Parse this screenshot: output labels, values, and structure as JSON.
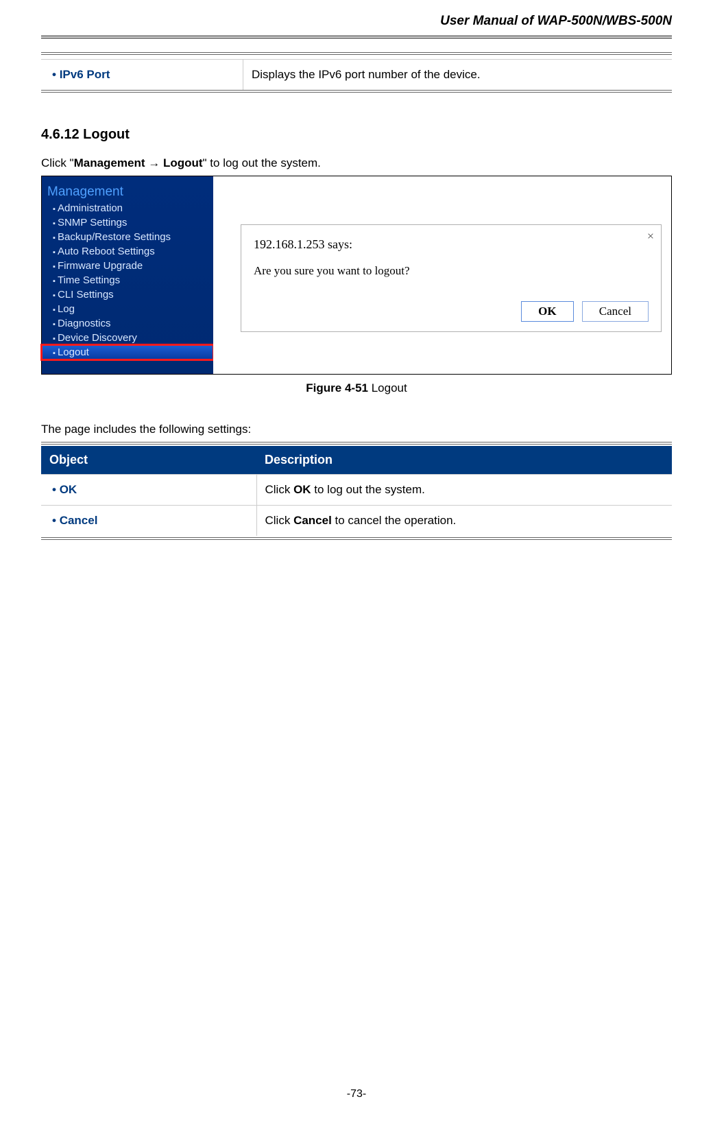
{
  "header": {
    "title": "User Manual of WAP-500N/WBS-500N"
  },
  "top_table": {
    "label": "IPv6 Port",
    "desc": "Displays the IPv6 port number of the device."
  },
  "section": {
    "number": "4.6.12",
    "title": "Logout",
    "click_prefix": "Click \"",
    "click_bold": "Management → Logout",
    "click_suffix": "\" to log out the system."
  },
  "sidebar": {
    "heading": "Management",
    "items": [
      {
        "label": "Administration"
      },
      {
        "label": "SNMP Settings"
      },
      {
        "label": "Backup/Restore Settings"
      },
      {
        "label": "Auto Reboot Settings"
      },
      {
        "label": "Firmware Upgrade"
      },
      {
        "label": "Time Settings"
      },
      {
        "label": "CLI Settings"
      },
      {
        "label": "Log"
      },
      {
        "label": "Diagnostics"
      },
      {
        "label": "Device Discovery"
      },
      {
        "label": "Logout"
      }
    ],
    "selected_index": 10
  },
  "dialog": {
    "source": "192.168.1.253 says:",
    "message": "Are you sure you want to logout?",
    "ok": "OK",
    "cancel": "Cancel",
    "close": "×"
  },
  "figcaption": {
    "bold": "Figure 4-51",
    "rest": " Logout"
  },
  "settings_intro": "The page includes the following settings:",
  "settings_table": {
    "head": {
      "c1": "Object",
      "c2": "Description"
    },
    "rows": [
      {
        "label": "OK",
        "desc_pre": "Click ",
        "desc_bold": "OK",
        "desc_post": " to log out the system."
      },
      {
        "label": "Cancel",
        "desc_pre": "Click ",
        "desc_bold": "Cancel",
        "desc_post": " to cancel the operation."
      }
    ]
  },
  "footer": "-73-"
}
